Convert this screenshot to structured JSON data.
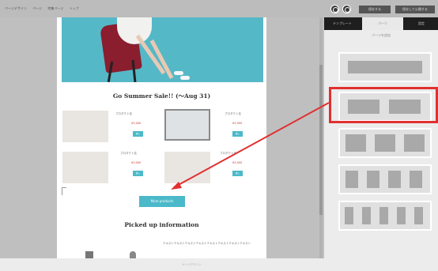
{
  "toolbar": {
    "breadcrumbs": [
      "ページデザイン",
      "ページ",
      "特集ページ",
      "トップ"
    ],
    "btn_save": "保存する",
    "btn_publish": "保存して公開する"
  },
  "page": {
    "sale_title": "Go Summer Sale!! (〜Aug 31)",
    "products": [
      {
        "name": "プロダクト名",
        "price": "¥3,000",
        "button": "購入"
      },
      {
        "name": "プロダクト名",
        "price": "¥3,000",
        "button": "購入"
      },
      {
        "name": "プロダクト名",
        "price": "¥3,000",
        "button": "購入"
      },
      {
        "name": "プロダクト名",
        "price": "¥3,000",
        "button": "購入"
      }
    ],
    "more_button": "More products",
    "pick_title": "Picked up information",
    "pick_text": "テキストテキストテキストテキストテキストテキストテキストテキスト"
  },
  "panel": {
    "tabs": [
      "テンプレート",
      "パーツ",
      "設定"
    ],
    "active_tab": 1,
    "subtitle": "パーツを追加"
  },
  "footer": {
    "text": "ページデザイン"
  },
  "colors": {
    "accent": "#4bb9c9",
    "highlight": "#e03030",
    "hero": "#55b8c7"
  },
  "icons": [
    "preview-icon",
    "undo-icon"
  ]
}
